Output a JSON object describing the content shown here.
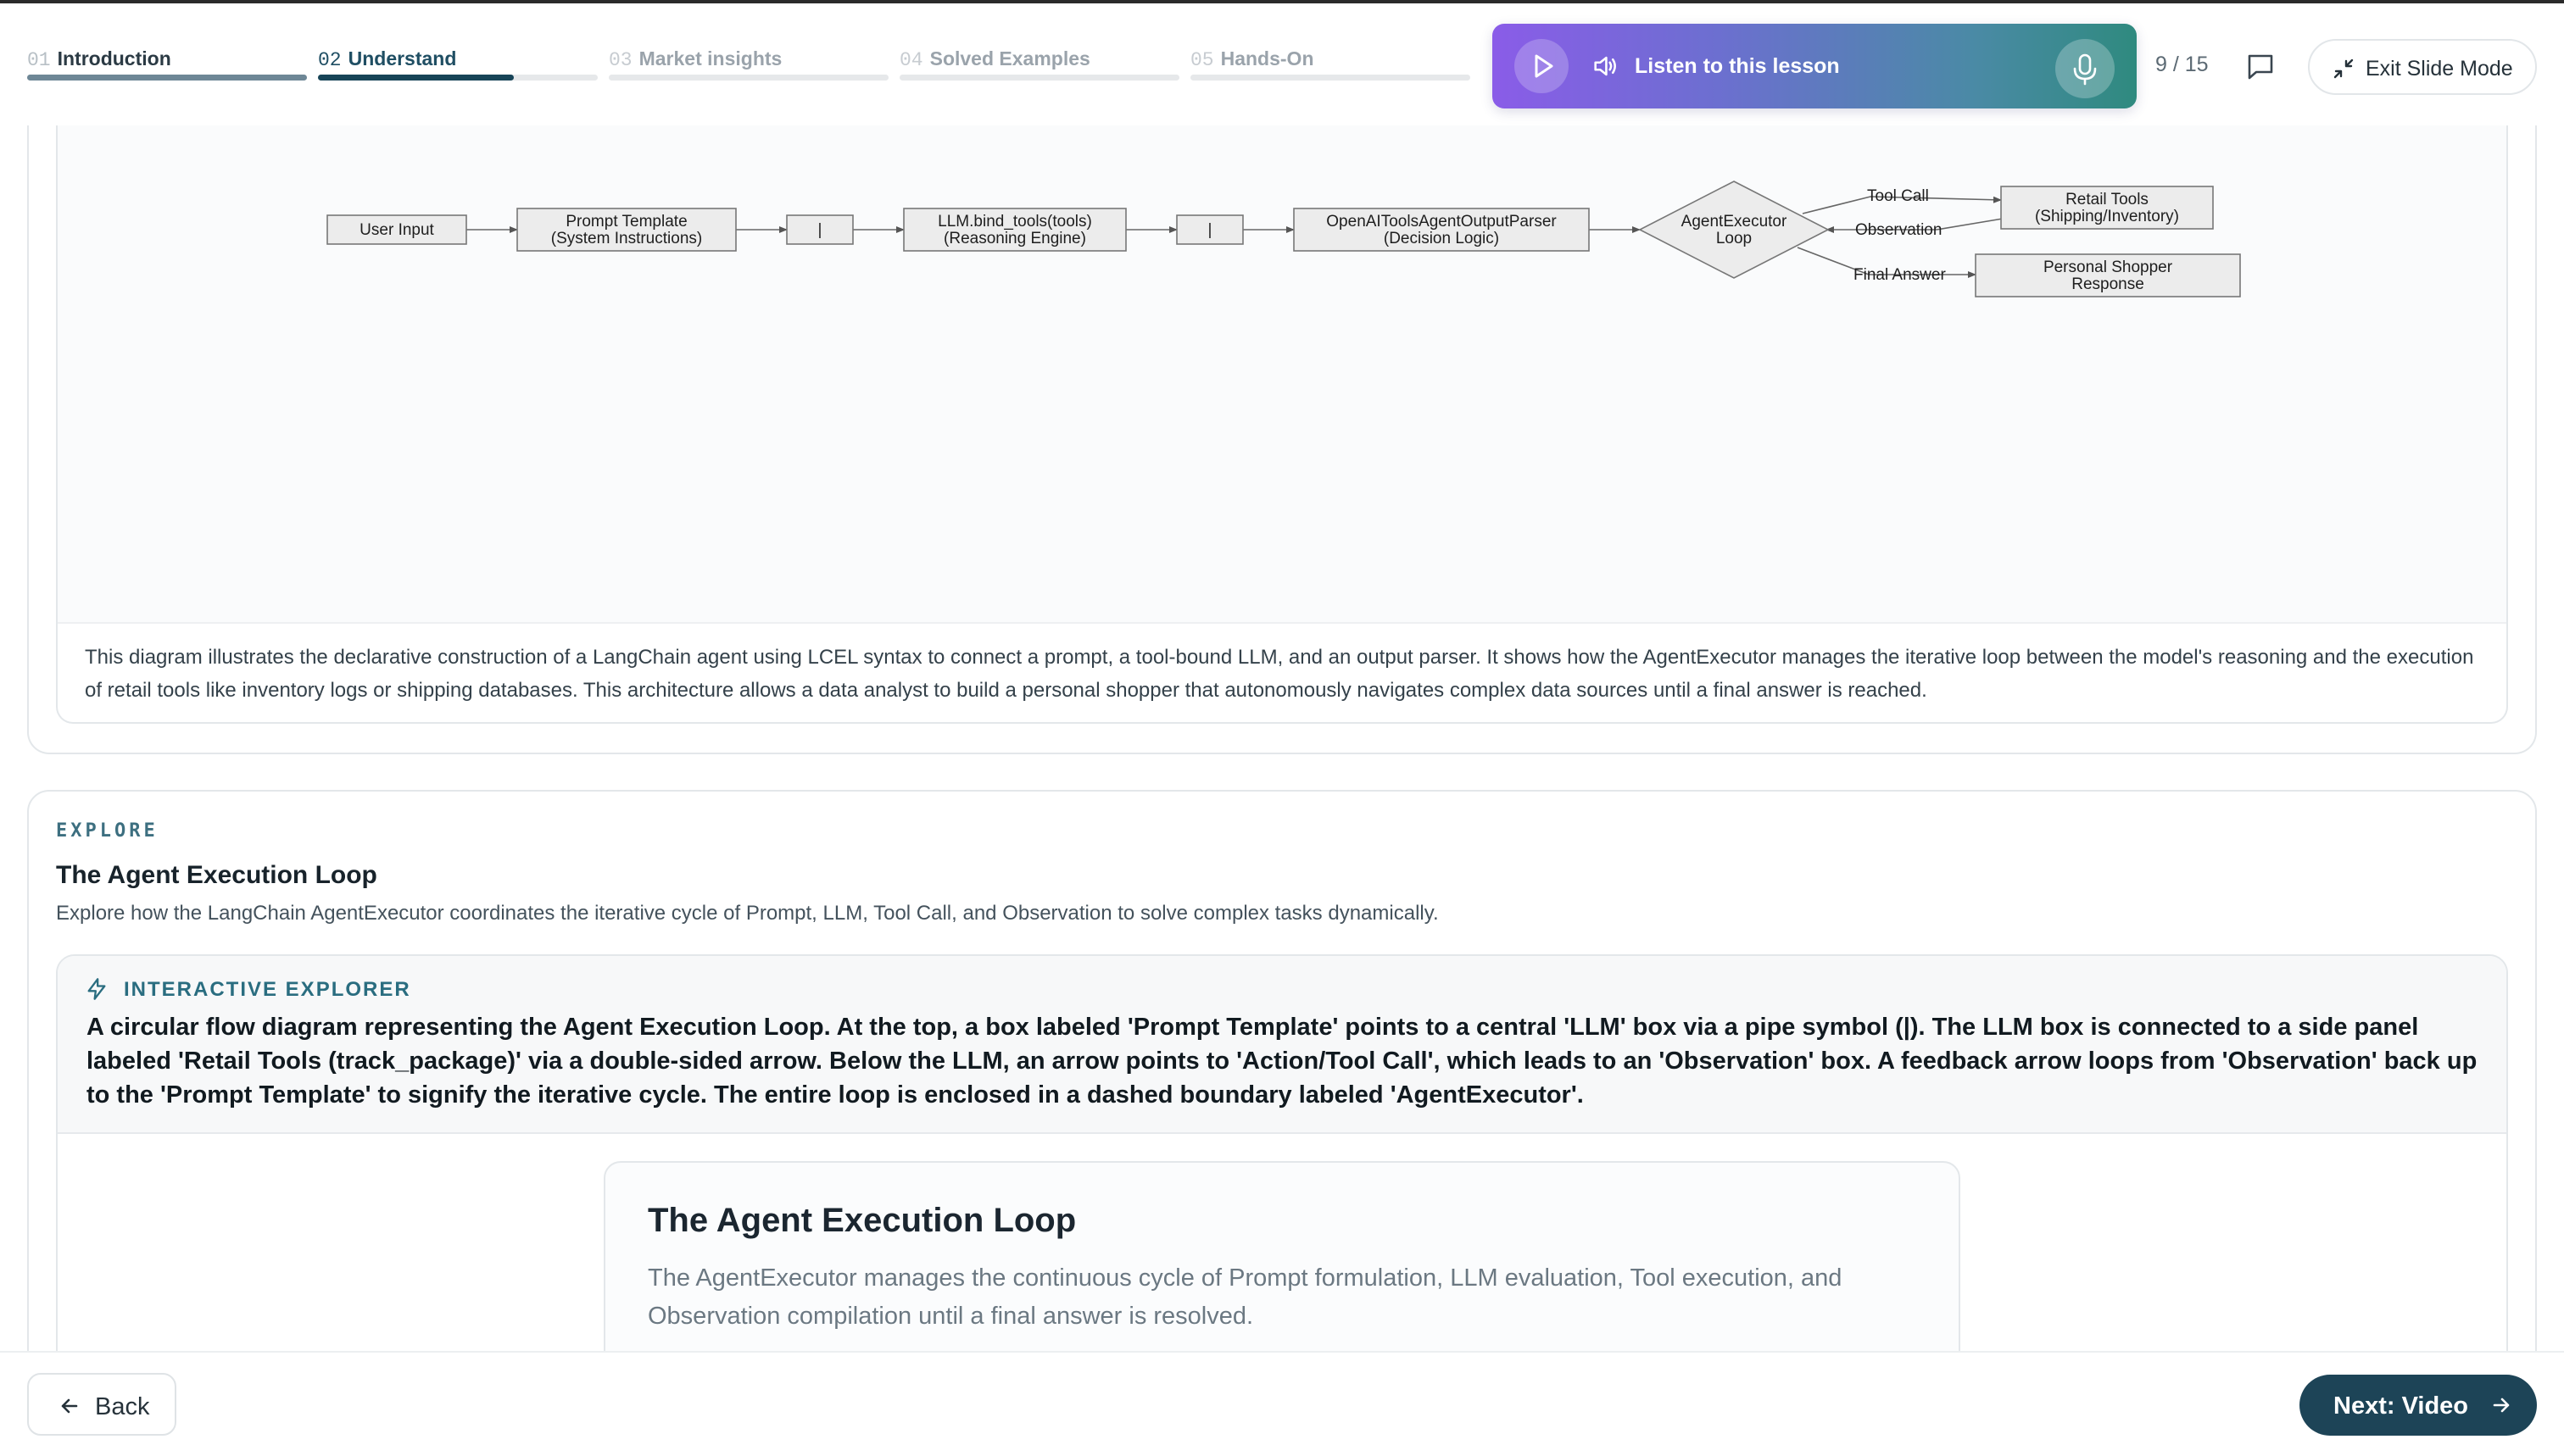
{
  "steps": [
    {
      "num": "01",
      "label": "Introduction",
      "state": "done"
    },
    {
      "num": "02",
      "label": "Understand",
      "state": "active"
    },
    {
      "num": "03",
      "label": "Market insights",
      "state": "todo"
    },
    {
      "num": "04",
      "label": "Solved Examples",
      "state": "todo"
    },
    {
      "num": "05",
      "label": "Hands-On",
      "state": "todo"
    }
  ],
  "audio": {
    "label": "Listen to this lesson"
  },
  "page_count": "9 / 15",
  "exit_label": "Exit Slide Mode",
  "diagram": {
    "nodes": {
      "user_input": "User Input",
      "prompt_template": [
        "Prompt Template",
        "(System Instructions)"
      ],
      "pipe1": "|",
      "llm": [
        "LLM.bind_tools(tools)",
        "(Reasoning Engine)"
      ],
      "pipe2": "|",
      "parser": [
        "OpenAIToolsAgentOutputParser",
        "(Decision Logic)"
      ],
      "executor": [
        "AgentExecutor",
        "Loop"
      ],
      "retail_tools": [
        "Retail Tools",
        "(Shipping/Inventory)"
      ],
      "shopper": [
        "Personal Shopper",
        "Response"
      ]
    },
    "edges": {
      "tool_call": "Tool Call",
      "observation": "Observation",
      "final_answer": "Final Answer"
    },
    "caption": "This diagram illustrates the declarative construction of a LangChain agent using LCEL syntax to connect a prompt, a tool-bound LLM, and an output parser. It shows how the AgentExecutor manages the iterative loop between the model's reasoning and the execution of retail tools like inventory logs or shipping databases. This architecture allows a data analyst to build a personal shopper that autonomously navigates complex data sources until a final answer is reached."
  },
  "explore": {
    "tag": "EXPLORE",
    "title": "The Agent Execution Loop",
    "description": "Explore how the LangChain AgentExecutor coordinates the iterative cycle of Prompt, LLM, Tool Call, and Observation to solve complex tasks dynamically."
  },
  "interactive": {
    "tag": "INTERACTIVE EXPLORER",
    "description": "A circular flow diagram representing the Agent Execution Loop. At the top, a box labeled 'Prompt Template' points to a central 'LLM' box via a pipe symbol (|). The LLM box is connected to a side panel labeled 'Retail Tools (track_package)' via a double-sided arrow. Below the LLM, an arrow points to 'Action/Tool Call', which leads to an 'Observation' box. A feedback arrow loops from 'Observation' back up to the 'Prompt Template' to signify the iterative cycle. The entire loop is enclosed in a dashed boundary labeled 'AgentExecutor'.",
    "card_title": "The Agent Execution Loop",
    "card_subtitle": "The AgentExecutor manages the continuous cycle of Prompt formulation, LLM evaluation, Tool execution, and Observation compilation until a final answer is resolved."
  },
  "nav": {
    "back_label": "Back",
    "next_label": "Next: Video"
  },
  "colors": {
    "accent": "#1d4457",
    "gradient_start": "#8a5ce8",
    "gradient_end": "#2f8a7f"
  }
}
